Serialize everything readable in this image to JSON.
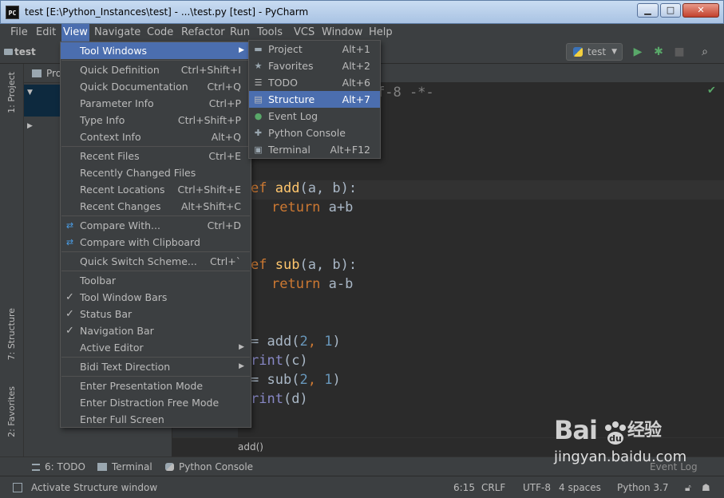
{
  "window": {
    "title": "test [E:\\Python_Instances\\test] - ...\\test.py [test] - PyCharm",
    "app_icon": "PC",
    "controls": [
      "minimize",
      "maximize",
      "close"
    ]
  },
  "menubar": [
    "File",
    "Edit",
    "View",
    "Navigate",
    "Code",
    "Refactor",
    "Run",
    "Tools",
    "VCS",
    "Window",
    "Help"
  ],
  "navbar": {
    "crumb": "test",
    "run_config": "test"
  },
  "left_tabs": {
    "project": "1: Project",
    "structure": "7: Structure",
    "favorites": "2: Favorites"
  },
  "project_panel": {
    "header": "Pro"
  },
  "editor": {
    "line1": "f-8 -*-",
    "def_add_kw": "ef",
    "def_add_name": "add",
    "def_add_params": "(a, b):",
    "return1_kw": "return",
    "return1_expr": "a+b",
    "def_sub_kw": "ef",
    "def_sub_name": "sub",
    "def_sub_params": "(a, b):",
    "return2_kw": "return",
    "return2_expr": "a-b",
    "call1_prefix": "=",
    "call1_fn": "add(",
    "call1_a": "2",
    "call1_sep": ",",
    "call1_b": "1",
    "call1_end": ")",
    "print1_bi": "rint",
    "print1_arg": "(c)",
    "call2_prefix": "=",
    "call2_fn": "sub(",
    "call2_a": "2",
    "call2_sep": ",",
    "call2_b": "1",
    "call2_end": ")",
    "print2_bi": "rint",
    "print2_arg": "(d)",
    "breadcrumb": "add()"
  },
  "view_menu": [
    {
      "label": "Tool Windows",
      "shortcut": "",
      "submenu": true,
      "highlighted": true
    },
    {
      "sep": true
    },
    {
      "label": "Quick Definition",
      "shortcut": "Ctrl+Shift+I"
    },
    {
      "label": "Quick Documentation",
      "shortcut": "Ctrl+Q"
    },
    {
      "label": "Parameter Info",
      "shortcut": "Ctrl+P"
    },
    {
      "label": "Type Info",
      "shortcut": "Ctrl+Shift+P"
    },
    {
      "label": "Context Info",
      "shortcut": "Alt+Q"
    },
    {
      "sep": true
    },
    {
      "label": "Recent Files",
      "shortcut": "Ctrl+E"
    },
    {
      "label": "Recently Changed Files",
      "shortcut": ""
    },
    {
      "label": "Recent Locations",
      "shortcut": "Ctrl+Shift+E"
    },
    {
      "label": "Recent Changes",
      "shortcut": "Alt+Shift+C"
    },
    {
      "sep": true
    },
    {
      "label": "Compare With...",
      "shortcut": "Ctrl+D",
      "icon": "compare-icon"
    },
    {
      "label": "Compare with Clipboard",
      "shortcut": "",
      "icon": "compare-clipboard-icon"
    },
    {
      "sep": true
    },
    {
      "label": "Quick Switch Scheme...",
      "shortcut": "Ctrl+`"
    },
    {
      "sep": true
    },
    {
      "label": "Toolbar",
      "shortcut": ""
    },
    {
      "label": "Tool Window Bars",
      "shortcut": "",
      "checked": true
    },
    {
      "label": "Status Bar",
      "shortcut": "",
      "checked": true
    },
    {
      "label": "Navigation Bar",
      "shortcut": "",
      "checked": true
    },
    {
      "label": "Active Editor",
      "shortcut": "",
      "submenu": true
    },
    {
      "sep": true
    },
    {
      "label": "Bidi Text Direction",
      "shortcut": "",
      "submenu": true
    },
    {
      "sep": true
    },
    {
      "label": "Enter Presentation Mode",
      "shortcut": ""
    },
    {
      "label": "Enter Distraction Free Mode",
      "shortcut": ""
    },
    {
      "label": "Enter Full Screen",
      "shortcut": ""
    }
  ],
  "tool_windows_menu": [
    {
      "label": "Project",
      "shortcut": "Alt+1",
      "icon": "folder-icon"
    },
    {
      "label": "Favorites",
      "shortcut": "Alt+2",
      "icon": "star-icon"
    },
    {
      "label": "TODO",
      "shortcut": "Alt+6",
      "icon": "todo-icon"
    },
    {
      "label": "Structure",
      "shortcut": "Alt+7",
      "icon": "structure-icon",
      "highlighted": true
    },
    {
      "label": "Event Log",
      "shortcut": "",
      "icon": "event-log-icon"
    },
    {
      "label": "Python Console",
      "shortcut": "",
      "icon": "python-console-icon"
    },
    {
      "label": "Terminal",
      "shortcut": "Alt+F12",
      "icon": "terminal-icon"
    }
  ],
  "bottom_tools": {
    "todo": "6: TODO",
    "terminal": "Terminal",
    "python_console": "Python Console",
    "event_log": "Event Log"
  },
  "statusbar": {
    "message": "Activate Structure window",
    "position": "6:15",
    "line_sep": "CRLF",
    "encoding": "UTF-8",
    "indent": "4 spaces",
    "interpreter": "Python 3.7"
  },
  "watermark": {
    "logo_text": "Bai",
    "logo_cn": "经验",
    "url": "jingyan.baidu.com"
  },
  "colors": {
    "menu_highlight": "#4b6eaf",
    "editor_bg": "#2b2b2b",
    "ui_bg": "#3c3f41",
    "keyword": "#cc7832",
    "function": "#ffc66d",
    "number": "#6897bb"
  }
}
